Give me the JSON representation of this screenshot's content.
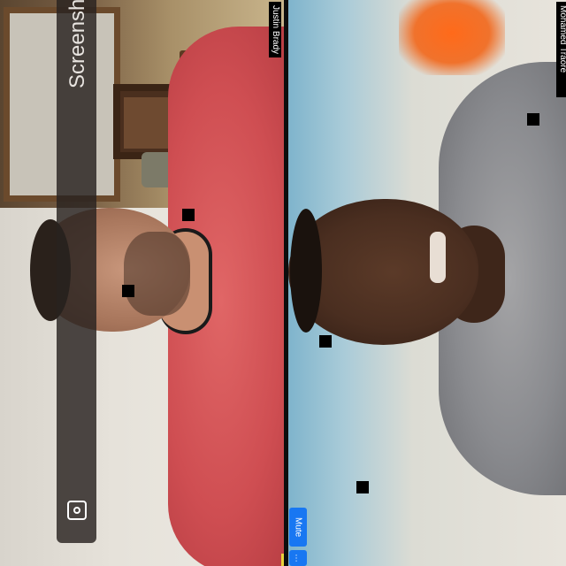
{
  "participants": {
    "left_name": "Justin Brady",
    "right_name": "Mohamed Traore"
  },
  "overlay": {
    "screenshot_label": "Screenshot",
    "screenshot_icon": "screenshot-capture-icon"
  },
  "controls": {
    "mute_label": "Mute",
    "more_label": "…"
  },
  "colors": {
    "button_blue": "#1877f2",
    "name_tag_bg": "#000000"
  }
}
